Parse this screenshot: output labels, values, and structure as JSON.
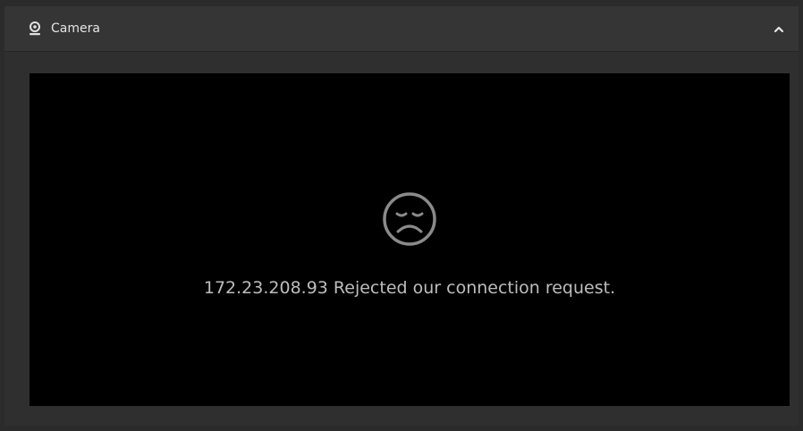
{
  "panel": {
    "title": "Camera",
    "icon": "camera-icon",
    "collapse_icon": "chevron-up-icon"
  },
  "stream": {
    "status_icon": "sad-face-icon",
    "message": "172.23.208.93 Rejected our connection request."
  },
  "colors": {
    "background": "#2b2b2b",
    "panel_header": "#353535",
    "viewport": "#000000",
    "message_text": "#bdbdbd",
    "title_text": "#e4e4e4"
  }
}
